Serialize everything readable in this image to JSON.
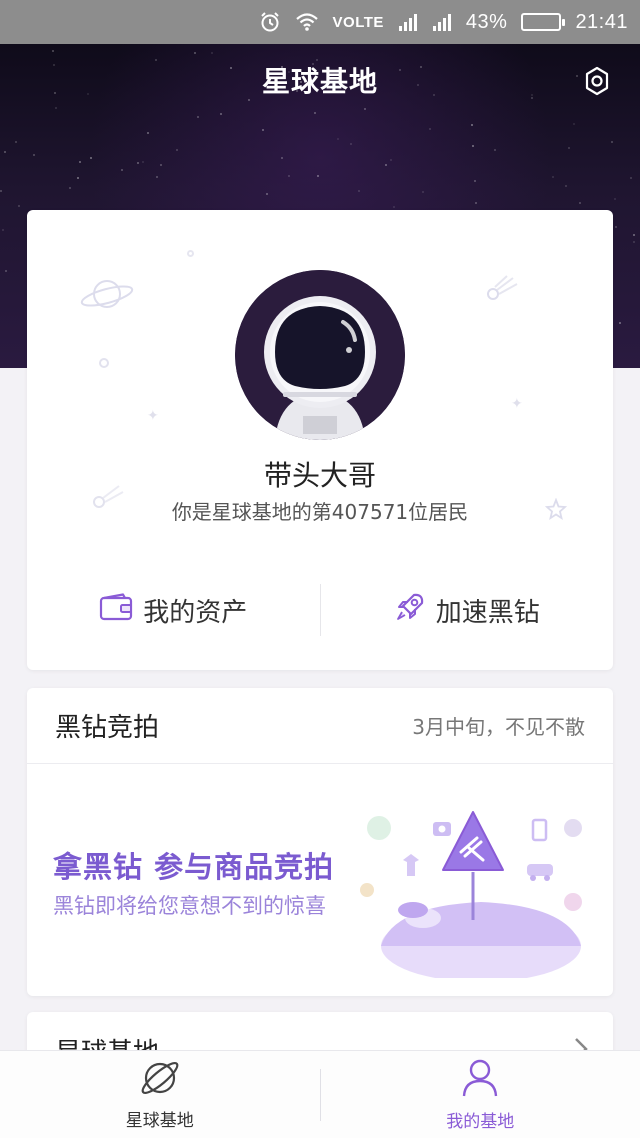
{
  "status_bar": {
    "network": "VOLTE",
    "battery": "43%",
    "battery_level": 0.43,
    "time": "21:41"
  },
  "header": {
    "title": "星球基地"
  },
  "profile": {
    "username": "带头大哥",
    "resident_text": "你是星球基地的第407571位居民",
    "actions": [
      {
        "label": "我的资产",
        "icon": "wallet-icon"
      },
      {
        "label": "加速黑钻",
        "icon": "rocket-icon"
      }
    ]
  },
  "auction": {
    "title": "黑钻竞拍",
    "note": "3月中旬，不见不散",
    "promo_title": "拿黑钻 参与商品竞拍",
    "promo_sub": "黑钻即将给您意想不到的惊喜"
  },
  "base_section": {
    "title": "星球基地"
  },
  "bottom_nav": {
    "items": [
      {
        "label": "星球基地",
        "icon": "planet-icon",
        "active": false
      },
      {
        "label": "我的基地",
        "icon": "person-icon",
        "active": true
      }
    ]
  },
  "colors": {
    "accent": "#8a5bd6",
    "header_bg": "#1f1530",
    "page_bg": "#f3f2f6"
  }
}
